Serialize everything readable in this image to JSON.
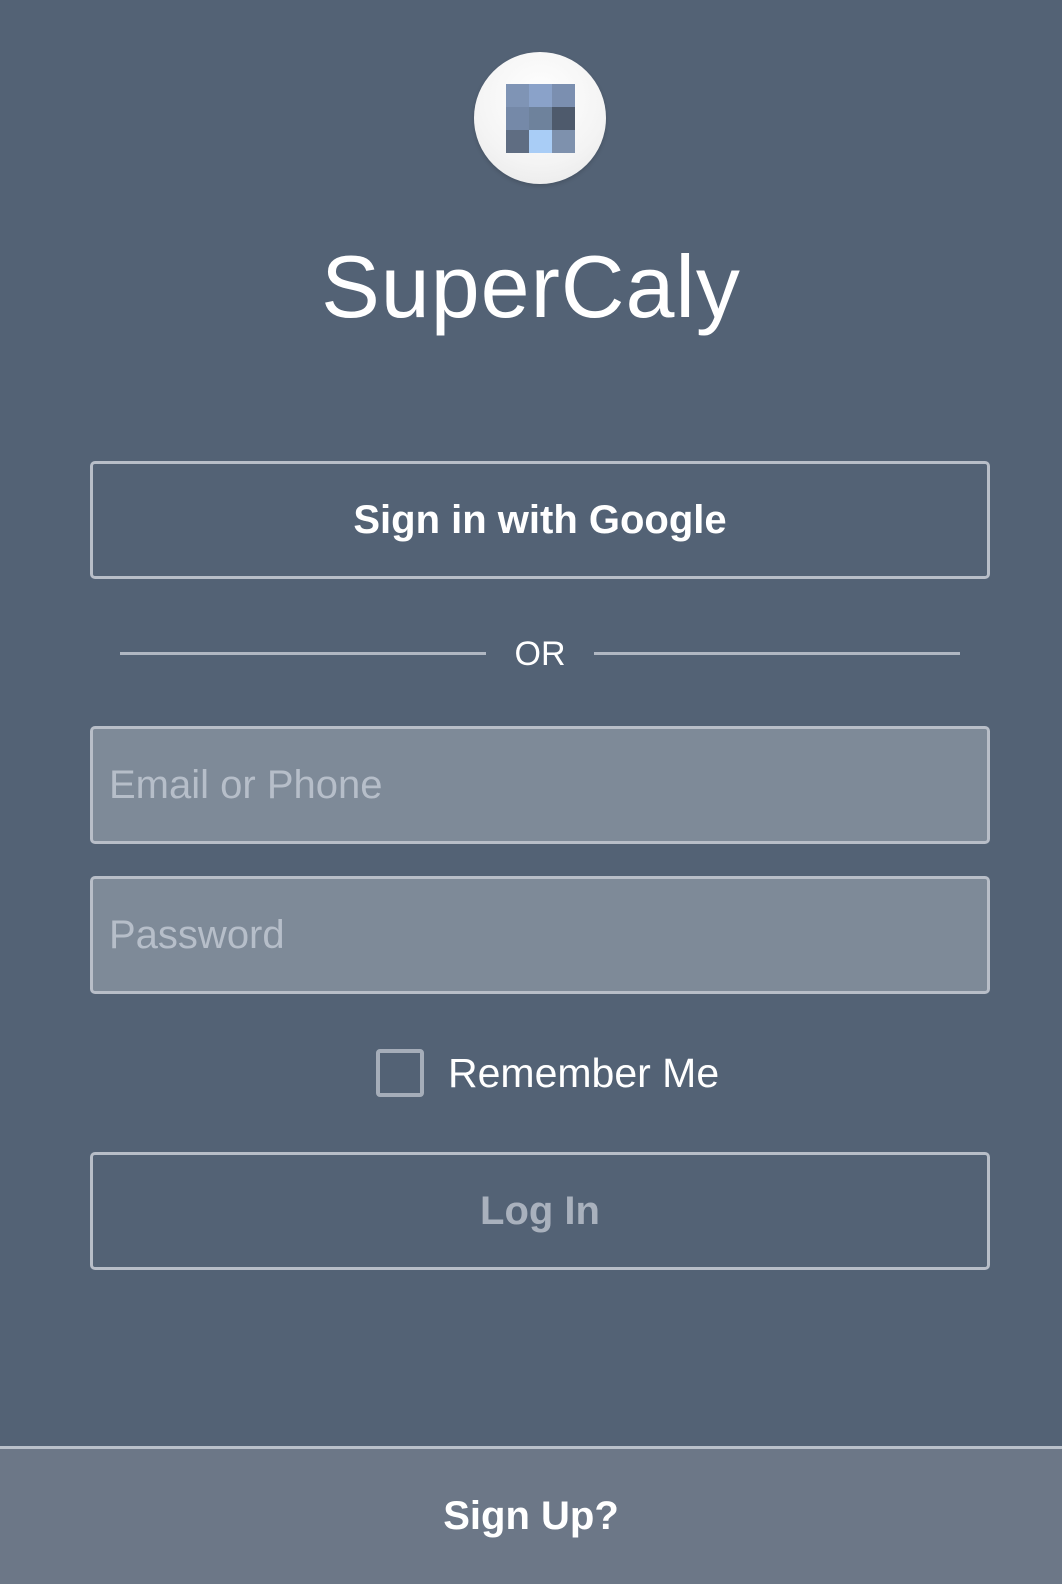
{
  "app": {
    "title": "SuperCaly",
    "logo_icon": "pixel-grid-logo-icon",
    "logo_colors": [
      "#7f94b5",
      "#8aa2c9",
      "#7b8fb0",
      "#7589a8",
      "#6e829c",
      "#4e5a6c",
      "#5f6d82",
      "#a9cdf6",
      "#7e91ad"
    ]
  },
  "auth": {
    "google_button_label": "Sign in with Google",
    "divider_text": "OR",
    "email_placeholder": "Email or Phone",
    "email_value": "",
    "password_placeholder": "Password",
    "password_value": "",
    "remember_label": "Remember Me",
    "remember_checked": false,
    "login_button_label": "Log In"
  },
  "footer": {
    "signup_label": "Sign Up?"
  },
  "colors": {
    "background": "#536275",
    "input_fill": "#7e8a98",
    "footer_fill": "#6c7787",
    "disabled_text": "#a9b1bd"
  }
}
